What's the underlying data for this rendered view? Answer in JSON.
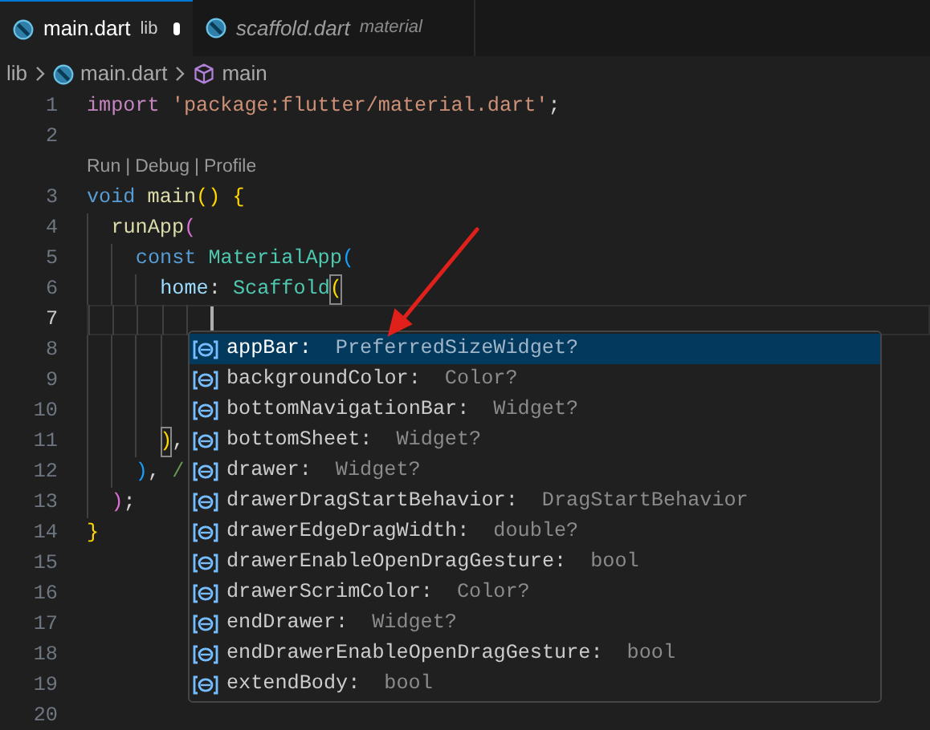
{
  "tabs": [
    {
      "label": "main.dart",
      "description": "lib",
      "modified": true,
      "selected": true,
      "preview": false
    },
    {
      "label": "scaffold.dart",
      "description": "material",
      "modified": false,
      "selected": false,
      "preview": true
    }
  ],
  "breadcrumbs": [
    {
      "label": "lib",
      "kind": "folder"
    },
    {
      "label": "main.dart",
      "kind": "file"
    },
    {
      "label": "main",
      "kind": "symbol"
    }
  ],
  "editor": {
    "lines": [
      {
        "number": "1",
        "current": false,
        "tokens": [
          {
            "text": "import ",
            "kind": "control"
          },
          {
            "text": "'package:flutter/material.dart'",
            "kind": "string"
          },
          {
            "text": ";",
            "kind": "plain"
          }
        ]
      },
      {
        "number": "2",
        "current": false
      },
      {
        "number": "3",
        "current": false,
        "codelens": {
          "items": [
            "Run",
            "Debug",
            "Profile"
          ],
          "separator": "|"
        },
        "tokens": [
          {
            "text": "void ",
            "kind": "keyword"
          },
          {
            "text": "main",
            "kind": "function"
          },
          {
            "text": "() {",
            "kind": "bracket1"
          }
        ],
        "children": [
          {
            "number": "4",
            "current": false,
            "tokens": [
              {
                "text": "runApp",
                "kind": "function"
              },
              {
                "text": "(",
                "kind": "bracket2"
              }
            ],
            "children": [
              {
                "number": "5",
                "current": false,
                "tokens": [
                  {
                    "text": "const ",
                    "kind": "keyword"
                  },
                  {
                    "text": "MaterialApp",
                    "kind": "type"
                  },
                  {
                    "text": "(",
                    "kind": "bracket3"
                  }
                ],
                "children": [
                  {
                    "number": "6",
                    "current": false,
                    "tokens": [
                      {
                        "text": "home",
                        "kind": "property"
                      },
                      {
                        "text": ": ",
                        "kind": "plain"
                      },
                      {
                        "text": "Scaffold",
                        "kind": "type"
                      },
                      {
                        "text": "(",
                        "kind": "bracket1-boxed"
                      }
                    ],
                    "children": [
                      {
                        "number": "7",
                        "current": true
                      },
                      {
                        "number": "8",
                        "current": false
                      },
                      {
                        "number": "9",
                        "current": false
                      },
                      {
                        "number": "10",
                        "current": false
                      }
                    ]
                  },
                  {
                    "number": "11",
                    "current": false,
                    "tokens": [
                      {
                        "text": ")",
                        "kind": "bracket1-boxed"
                      },
                      {
                        "text": ",",
                        "kind": "plain"
                      }
                    ]
                  }
                ]
              },
              {
                "number": "12",
                "current": false,
                "tokens": [
                  {
                    "text": ")",
                    "kind": "bracket3"
                  },
                  {
                    "text": ", ",
                    "kind": "plain"
                  },
                  {
                    "text": "/",
                    "kind": "comment"
                  }
                ]
              }
            ]
          },
          {
            "number": "13",
            "current": false,
            "tokens": [
              {
                "text": ")",
                "kind": "bracket2"
              },
              {
                "text": ";",
                "kind": "plain"
              }
            ]
          }
        ]
      },
      {
        "number": "14",
        "current": false,
        "tokens": [
          {
            "text": "}",
            "kind": "bracket1"
          }
        ]
      },
      {
        "number": "15",
        "current": false
      },
      {
        "number": "16",
        "current": false
      },
      {
        "number": "17",
        "current": false
      },
      {
        "number": "18",
        "current": false
      },
      {
        "number": "19",
        "current": false
      },
      {
        "number": "20",
        "current": false
      }
    ]
  },
  "suggestions": [
    {
      "name": "appBar:",
      "type": "PreferredSizeWidget?",
      "selected": true
    },
    {
      "name": "backgroundColor:",
      "type": "Color?",
      "selected": false
    },
    {
      "name": "bottomNavigationBar:",
      "type": "Widget?",
      "selected": false
    },
    {
      "name": "bottomSheet:",
      "type": "Widget?",
      "selected": false
    },
    {
      "name": "drawer:",
      "type": "Widget?",
      "selected": false
    },
    {
      "name": "drawerDragStartBehavior:",
      "type": "DragStartBehavior",
      "selected": false
    },
    {
      "name": "drawerEdgeDragWidth:",
      "type": "double?",
      "selected": false
    },
    {
      "name": "drawerEnableOpenDragGesture:",
      "type": "bool",
      "selected": false
    },
    {
      "name": "drawerScrimColor:",
      "type": "Color?",
      "selected": false
    },
    {
      "name": "endDrawer:",
      "type": "Widget?",
      "selected": false
    },
    {
      "name": "endDrawerEnableOpenDragGesture:",
      "type": "bool",
      "selected": false
    },
    {
      "name": "extendBody:",
      "type": "bool",
      "selected": false
    }
  ]
}
